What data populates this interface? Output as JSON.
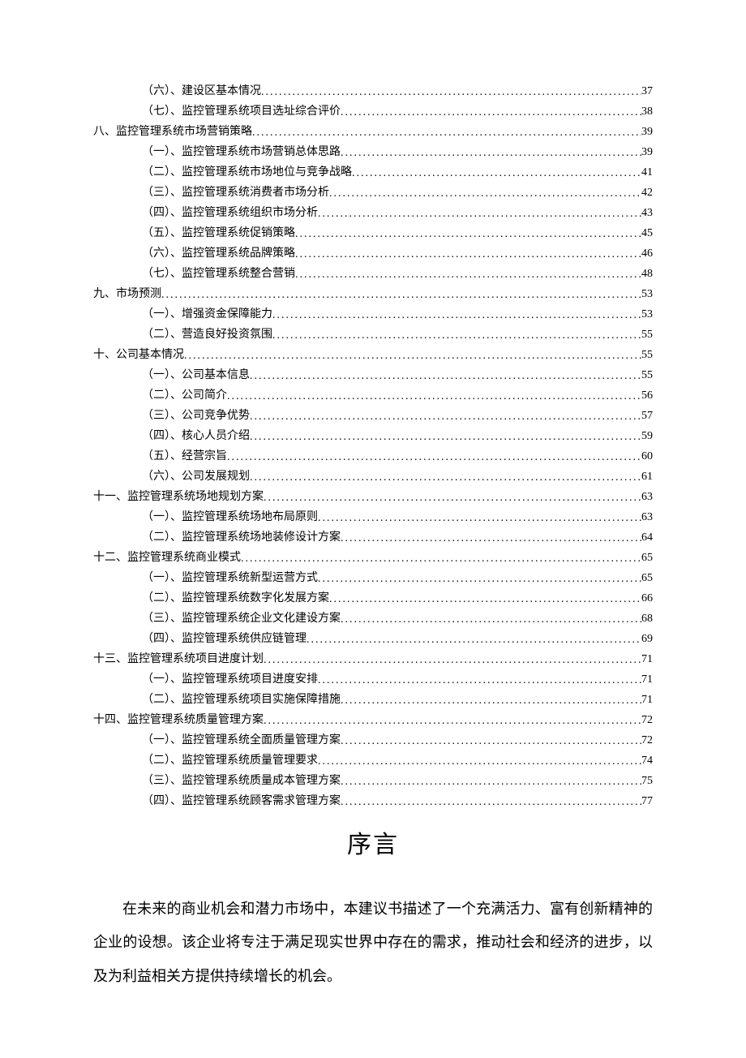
{
  "toc": [
    {
      "level": 2,
      "label": "（六）、建设区基本情况",
      "page": "37"
    },
    {
      "level": 2,
      "label": "（七）、监控管理系统项目选址综合评价",
      "page": "38"
    },
    {
      "level": 1,
      "label": "八、监控管理系统市场营销策略",
      "page": "39"
    },
    {
      "level": 2,
      "label": "（一）、监控管理系统市场营销总体思路",
      "page": "39"
    },
    {
      "level": 2,
      "label": "（二）、监控管理系统市场地位与竞争战略",
      "page": "41"
    },
    {
      "level": 2,
      "label": "（三）、监控管理系统消费者市场分析",
      "page": "42"
    },
    {
      "level": 2,
      "label": "（四）、监控管理系统组织市场分析",
      "page": "43"
    },
    {
      "level": 2,
      "label": "（五）、监控管理系统促销策略",
      "page": "45"
    },
    {
      "level": 2,
      "label": "（六）、监控管理系统品牌策略",
      "page": "46"
    },
    {
      "level": 2,
      "label": "（七）、监控管理系统整合营销",
      "page": "48"
    },
    {
      "level": 1,
      "label": "九、市场预测",
      "page": "53"
    },
    {
      "level": 2,
      "label": "（一）、增强资金保障能力",
      "page": "53"
    },
    {
      "level": 2,
      "label": "（二）、营造良好投资氛围",
      "page": "55"
    },
    {
      "level": 1,
      "label": "十、公司基本情况",
      "page": "55"
    },
    {
      "level": 2,
      "label": "（一）、公司基本信息",
      "page": "55"
    },
    {
      "level": 2,
      "label": "（二）、公司简介",
      "page": "56"
    },
    {
      "level": 2,
      "label": "（三）、公司竞争优势",
      "page": "57"
    },
    {
      "level": 2,
      "label": "（四）、核心人员介绍",
      "page": "59"
    },
    {
      "level": 2,
      "label": "（五）、经营宗旨",
      "page": "60"
    },
    {
      "level": 2,
      "label": "（六）、公司发展规划",
      "page": "61"
    },
    {
      "level": 1,
      "label": "十一、监控管理系统场地规划方案",
      "page": "63"
    },
    {
      "level": 2,
      "label": "（一）、监控管理系统场地布局原则",
      "page": "63"
    },
    {
      "level": 2,
      "label": "（二）、监控管理系统场地装修设计方案",
      "page": "64"
    },
    {
      "level": 1,
      "label": "十二、监控管理系统商业模式",
      "page": "65"
    },
    {
      "level": 2,
      "label": "（一）、监控管理系统新型运营方式",
      "page": "65"
    },
    {
      "level": 2,
      "label": "（二）、监控管理系统数字化发展方案",
      "page": "66"
    },
    {
      "level": 2,
      "label": "（三）、监控管理系统企业文化建设方案",
      "page": "68"
    },
    {
      "level": 2,
      "label": "（四）、监控管理系统供应链管理",
      "page": "69"
    },
    {
      "level": 1,
      "label": "十三、监控管理系统项目进度计划",
      "page": "71"
    },
    {
      "level": 2,
      "label": "（一）、监控管理系统项目进度安排",
      "page": "71"
    },
    {
      "level": 2,
      "label": "（二）、监控管理系统项目实施保障措施",
      "page": "71"
    },
    {
      "level": 1,
      "label": "十四、监控管理系统质量管理方案",
      "page": "72"
    },
    {
      "level": 2,
      "label": "（一）、监控管理系统全面质量管理方案",
      "page": "72"
    },
    {
      "level": 2,
      "label": "（二）、监控管理系统质量管理要求",
      "page": "74"
    },
    {
      "level": 2,
      "label": "（三）、监控管理系统质量成本管理方案",
      "page": "75"
    },
    {
      "level": 2,
      "label": "（四）、监控管理系统顾客需求管理方案",
      "page": "77"
    }
  ],
  "preface": {
    "title": "序言",
    "paragraph": "在未来的商业机会和潜力市场中，本建议书描述了一个充满活力、富有创新精神的企业的设想。该企业将专注于满足现实世界中存在的需求，推动社会和经济的进步，以及为利益相关方提供持续增长的机会。"
  }
}
